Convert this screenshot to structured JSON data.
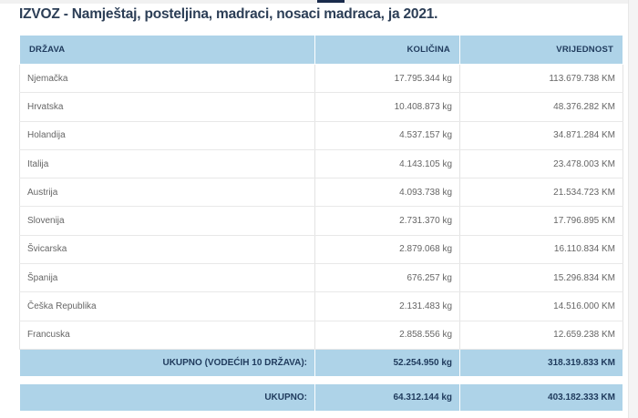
{
  "title": "IZVOZ - Namještaj, posteljina, madraci, nosaci madraca, ja 2021.",
  "table": {
    "headers": [
      "DRŽAVA",
      "KOLIČINA",
      "VRIJEDNOST"
    ],
    "rows": [
      [
        "Njemačka",
        "17.795.344 kg",
        "113.679.738 KM"
      ],
      [
        "Hrvatska",
        "10.408.873 kg",
        "48.376.282 KM"
      ],
      [
        "Holandija",
        "4.537.157 kg",
        "34.871.284 KM"
      ],
      [
        "Italija",
        "4.143.105 kg",
        "23.478.003 KM"
      ],
      [
        "Austrija",
        "4.093.738 kg",
        "21.534.723 KM"
      ],
      [
        "Slovenija",
        "2.731.370 kg",
        "17.796.895 KM"
      ],
      [
        "Švicarska",
        "2.879.068 kg",
        "16.110.834 KM"
      ],
      [
        "Španija",
        "676.257 kg",
        "15.296.834 KM"
      ],
      [
        "Češka Republika",
        "2.131.483 kg",
        "14.516.000 KM"
      ],
      [
        "Francuska",
        "2.858.556 kg",
        "12.659.238 KM"
      ]
    ],
    "subtotal": [
      "UKUPNO (VODEĆIH 10 DRŽAVA):",
      "52.254.950 kg",
      "318.319.833 KM"
    ],
    "total": [
      "UKUPNO:",
      "64.312.144 kg",
      "403.182.333 KM"
    ]
  },
  "colors": {
    "header_bg": "#aed3e8",
    "header_text": "#1f3a5c",
    "title_text": "#2c3e56"
  }
}
